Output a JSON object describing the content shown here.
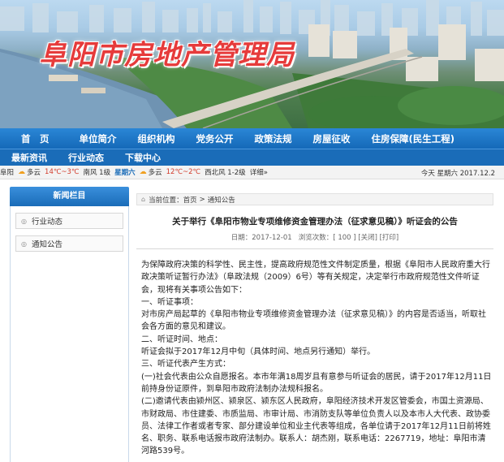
{
  "banner": {
    "site_title": "阜阳市房地产管理局"
  },
  "nav_main": [
    {
      "label": "首　页"
    },
    {
      "label": "单位简介"
    },
    {
      "label": "组织机构"
    },
    {
      "label": "党务公开"
    },
    {
      "label": "政策法规"
    },
    {
      "label": "房屋征收"
    },
    {
      "label": "住房保障(民生工程)"
    }
  ],
  "nav_sub": [
    {
      "label": "最新资讯"
    },
    {
      "label": "行业动态"
    },
    {
      "label": "下载中心"
    }
  ],
  "weather": {
    "city": "阜阳",
    "today_cond": "多云",
    "today_temp": "14℃~3℃",
    "today_wind": "南风 1级",
    "today_weekday": "星期六",
    "tomorrow_cond": "多云",
    "tomorrow_temp": "12℃~2℃",
    "tomorrow_wind": "西北风 1-2级",
    "details": "详细»",
    "date_text": "今天 星期六 2017.12.2"
  },
  "sidebar": {
    "title": "新闻栏目",
    "items": [
      {
        "label": "行业动态"
      },
      {
        "label": "通知公告"
      }
    ]
  },
  "breadcrumb": {
    "prefix": "当前位置：",
    "home": "首页",
    "sep": ">",
    "current": "通知公告"
  },
  "article": {
    "title": "关于举行《阜阳市物业专项维修资金管理办法（征求意见稿）》听证会的公告",
    "date_label": "日期：",
    "date": "2017-12-01",
    "views_label": "浏览次数：",
    "views": "[ 100 ]",
    "close_label": "[关闭]",
    "print_label": "[打印]",
    "paragraphs": [
      "为保障政府决策的科学性、民主性，提高政府规范性文件制定质量，根据《阜阳市人民政府重大行政决策听证暂行办法》（阜政法规（2009）6号）等有关规定，决定举行市政府规范性文件听证会，现将有关事项公告如下：",
      "一、听证事项：",
      "对市房产局起草的《阜阳市物业专项维修资金管理办法（征求意见稿）》的内容是否适当，听取社会各方面的意见和建议。",
      "二、听证时间、地点：",
      "听证会拟于2017年12月中旬（具体时间、地点另行通知）举行。",
      "三、听证代表产生方式：",
      "(一)社会代表由公众自愿报名。本市年满18周岁且有意参与听证会的居民，请于2017年12月11日前持身份证原件，到阜阳市政府法制办法规科报名。",
      "(二)邀请代表由颍州区、颍泉区、颍东区人民政府，阜阳经济技术开发区管委会，市国土资源局、市财政局、市住建委、市质监局、市审计局、市消防支队等单位负责人以及本市人大代表、政协委员、法律工作者或者专家、部分建设单位和业主代表等组成，各单位请于2017年12月11日前将姓名、职务、联系电话报市政府法制办。联系人：胡杰刚，联系电话：2267719，地址：阜阳市清河路539号。"
    ]
  }
}
